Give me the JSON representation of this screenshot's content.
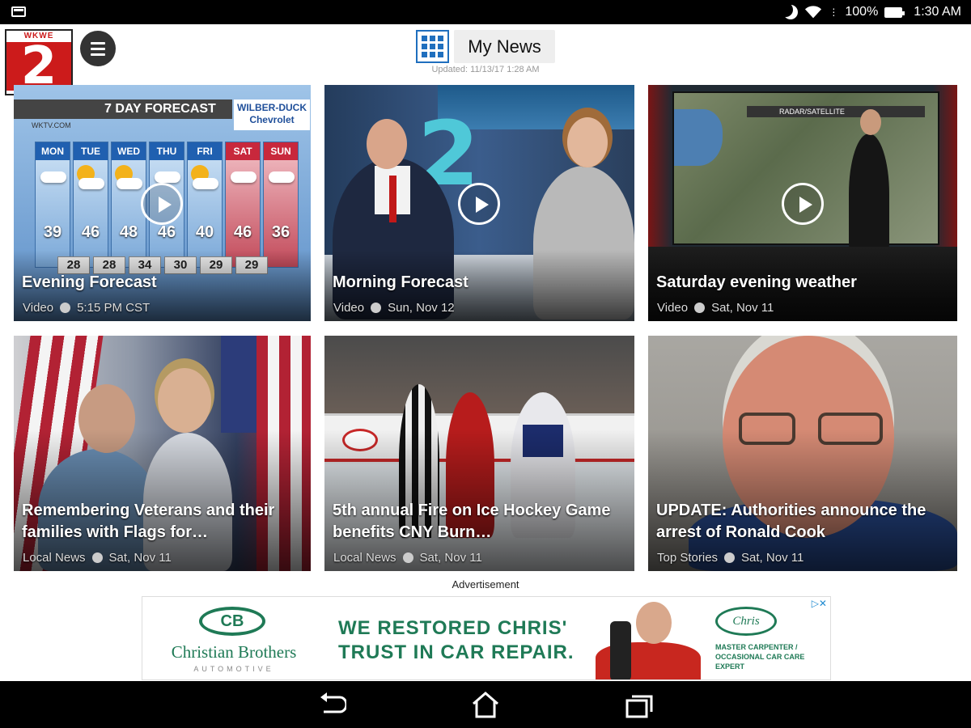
{
  "status_bar": {
    "battery": "100%",
    "time": "1:30 AM"
  },
  "header": {
    "logo_top": "WKWE Channel",
    "logo_number": "2",
    "title": "My News",
    "updated": "Updated: 11/13/17 1:28 AM"
  },
  "cards": [
    {
      "title": "Evening Forecast",
      "category": "Video",
      "time": "5:15 PM CST"
    },
    {
      "title": "Morning Forecast",
      "category": "Video",
      "time": "Sun, Nov 12"
    },
    {
      "title": "Saturday evening weather",
      "category": "Video",
      "time": "Sat, Nov 11"
    },
    {
      "title": "Remembering Veterans and their families with Flags for…",
      "category": "Local News",
      "time": "Sat, Nov 11"
    },
    {
      "title": "5th annual Fire on Ice Hockey Game benefits CNY Burn…",
      "category": "Local News",
      "time": "Sat, Nov 11"
    },
    {
      "title": "UPDATE: Authorities announce the arrest of Ronald Cook",
      "category": "Top Stories",
      "time": "Sat, Nov 11"
    }
  ],
  "forecast_graphic": {
    "banner": "7 DAY FORECAST",
    "sponsor_line1": "WILBER-DUCK",
    "sponsor_line2": "Chevrolet",
    "url": "WKTV.COM",
    "days": [
      {
        "day": "MON",
        "high": "39"
      },
      {
        "day": "TUE",
        "high": "46"
      },
      {
        "day": "WED",
        "high": "48"
      },
      {
        "day": "THU",
        "high": "46"
      },
      {
        "day": "FRI",
        "high": "40"
      },
      {
        "day": "SAT",
        "high": "46"
      },
      {
        "day": "SUN",
        "high": "36"
      }
    ],
    "lows": [
      "28",
      "28",
      "34",
      "30",
      "29",
      "29"
    ]
  },
  "radar_graphic": {
    "header": "RADAR/SATELLITE"
  },
  "ad": {
    "label": "Advertisement",
    "logo_letters": "CB",
    "brand": "Christian Brothers",
    "brand_sub": "AUTOMOTIVE",
    "headline_line1": "WE RESTORED CHRIS'",
    "headline_line2": "TRUST IN CAR REPAIR.",
    "right_logo": "Chris",
    "caption": "MASTER CARPENTER / OCCASIONAL CAR CARE EXPERT"
  },
  "colors": {
    "accent": "#1f6fbe",
    "ad_green": "#1f7a56",
    "logo_red": "#cc1b1b"
  }
}
